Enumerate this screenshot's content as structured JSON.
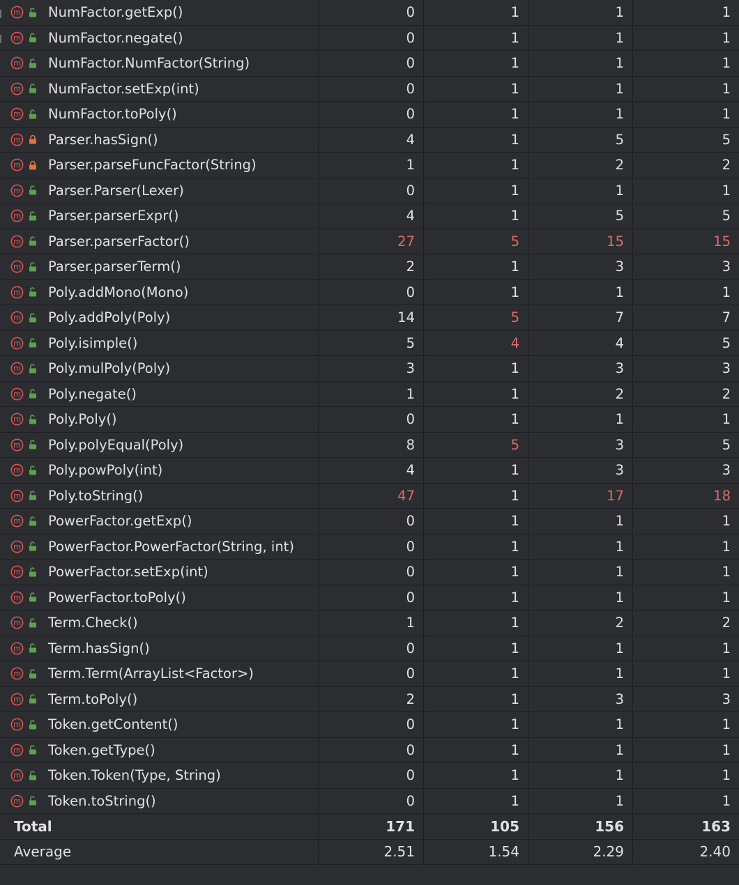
{
  "colors": {
    "background": "#2b2d30",
    "grid": "#1e1f22",
    "text": "#dfe1e5",
    "highlight": "#e06c6c",
    "method_icon": "#e05555",
    "public_lock": "#5fa04e",
    "private_lock": "#e0733d"
  },
  "rows": [
    {
      "name": "NumFactor.getExp()",
      "access": "public",
      "v": [
        "0",
        "1",
        "1",
        "1"
      ],
      "hot": [
        false,
        false,
        false,
        false
      ]
    },
    {
      "name": "NumFactor.negate()",
      "access": "public",
      "v": [
        "0",
        "1",
        "1",
        "1"
      ],
      "hot": [
        false,
        false,
        false,
        false
      ]
    },
    {
      "name": "NumFactor.NumFactor(String)",
      "access": "public",
      "v": [
        "0",
        "1",
        "1",
        "1"
      ],
      "hot": [
        false,
        false,
        false,
        false
      ]
    },
    {
      "name": "NumFactor.setExp(int)",
      "access": "public",
      "v": [
        "0",
        "1",
        "1",
        "1"
      ],
      "hot": [
        false,
        false,
        false,
        false
      ]
    },
    {
      "name": "NumFactor.toPoly()",
      "access": "public",
      "v": [
        "0",
        "1",
        "1",
        "1"
      ],
      "hot": [
        false,
        false,
        false,
        false
      ]
    },
    {
      "name": "Parser.hasSign()",
      "access": "private",
      "v": [
        "4",
        "1",
        "5",
        "5"
      ],
      "hot": [
        false,
        false,
        false,
        false
      ]
    },
    {
      "name": "Parser.parseFuncFactor(String)",
      "access": "private",
      "v": [
        "1",
        "1",
        "2",
        "2"
      ],
      "hot": [
        false,
        false,
        false,
        false
      ]
    },
    {
      "name": "Parser.Parser(Lexer)",
      "access": "public",
      "v": [
        "0",
        "1",
        "1",
        "1"
      ],
      "hot": [
        false,
        false,
        false,
        false
      ]
    },
    {
      "name": "Parser.parserExpr()",
      "access": "public",
      "v": [
        "4",
        "1",
        "5",
        "5"
      ],
      "hot": [
        false,
        false,
        false,
        false
      ]
    },
    {
      "name": "Parser.parserFactor()",
      "access": "public",
      "v": [
        "27",
        "5",
        "15",
        "15"
      ],
      "hot": [
        true,
        true,
        true,
        true
      ]
    },
    {
      "name": "Parser.parserTerm()",
      "access": "public",
      "v": [
        "2",
        "1",
        "3",
        "3"
      ],
      "hot": [
        false,
        false,
        false,
        false
      ]
    },
    {
      "name": "Poly.addMono(Mono)",
      "access": "public",
      "v": [
        "0",
        "1",
        "1",
        "1"
      ],
      "hot": [
        false,
        false,
        false,
        false
      ]
    },
    {
      "name": "Poly.addPoly(Poly)",
      "access": "public",
      "v": [
        "14",
        "5",
        "7",
        "7"
      ],
      "hot": [
        false,
        true,
        false,
        false
      ]
    },
    {
      "name": "Poly.isimple()",
      "access": "public",
      "v": [
        "5",
        "4",
        "4",
        "5"
      ],
      "hot": [
        false,
        true,
        false,
        false
      ]
    },
    {
      "name": "Poly.mulPoly(Poly)",
      "access": "public",
      "v": [
        "3",
        "1",
        "3",
        "3"
      ],
      "hot": [
        false,
        false,
        false,
        false
      ]
    },
    {
      "name": "Poly.negate()",
      "access": "public",
      "v": [
        "1",
        "1",
        "2",
        "2"
      ],
      "hot": [
        false,
        false,
        false,
        false
      ]
    },
    {
      "name": "Poly.Poly()",
      "access": "public",
      "v": [
        "0",
        "1",
        "1",
        "1"
      ],
      "hot": [
        false,
        false,
        false,
        false
      ]
    },
    {
      "name": "Poly.polyEqual(Poly)",
      "access": "public",
      "v": [
        "8",
        "5",
        "3",
        "5"
      ],
      "hot": [
        false,
        true,
        false,
        false
      ]
    },
    {
      "name": "Poly.powPoly(int)",
      "access": "public",
      "v": [
        "4",
        "1",
        "3",
        "3"
      ],
      "hot": [
        false,
        false,
        false,
        false
      ]
    },
    {
      "name": "Poly.toString()",
      "access": "public",
      "v": [
        "47",
        "1",
        "17",
        "18"
      ],
      "hot": [
        true,
        false,
        true,
        true
      ]
    },
    {
      "name": "PowerFactor.getExp()",
      "access": "public",
      "v": [
        "0",
        "1",
        "1",
        "1"
      ],
      "hot": [
        false,
        false,
        false,
        false
      ]
    },
    {
      "name": "PowerFactor.PowerFactor(String, int)",
      "access": "public",
      "v": [
        "0",
        "1",
        "1",
        "1"
      ],
      "hot": [
        false,
        false,
        false,
        false
      ]
    },
    {
      "name": "PowerFactor.setExp(int)",
      "access": "public",
      "v": [
        "0",
        "1",
        "1",
        "1"
      ],
      "hot": [
        false,
        false,
        false,
        false
      ]
    },
    {
      "name": "PowerFactor.toPoly()",
      "access": "public",
      "v": [
        "0",
        "1",
        "1",
        "1"
      ],
      "hot": [
        false,
        false,
        false,
        false
      ]
    },
    {
      "name": "Term.Check()",
      "access": "public",
      "v": [
        "1",
        "1",
        "2",
        "2"
      ],
      "hot": [
        false,
        false,
        false,
        false
      ]
    },
    {
      "name": "Term.hasSign()",
      "access": "public",
      "v": [
        "0",
        "1",
        "1",
        "1"
      ],
      "hot": [
        false,
        false,
        false,
        false
      ]
    },
    {
      "name": "Term.Term(ArrayList<Factor>)",
      "access": "public",
      "v": [
        "0",
        "1",
        "1",
        "1"
      ],
      "hot": [
        false,
        false,
        false,
        false
      ]
    },
    {
      "name": "Term.toPoly()",
      "access": "public",
      "v": [
        "2",
        "1",
        "3",
        "3"
      ],
      "hot": [
        false,
        false,
        false,
        false
      ]
    },
    {
      "name": "Token.getContent()",
      "access": "public",
      "v": [
        "0",
        "1",
        "1",
        "1"
      ],
      "hot": [
        false,
        false,
        false,
        false
      ]
    },
    {
      "name": "Token.getType()",
      "access": "public",
      "v": [
        "0",
        "1",
        "1",
        "1"
      ],
      "hot": [
        false,
        false,
        false,
        false
      ]
    },
    {
      "name": "Token.Token(Type, String)",
      "access": "public",
      "v": [
        "0",
        "1",
        "1",
        "1"
      ],
      "hot": [
        false,
        false,
        false,
        false
      ]
    },
    {
      "name": "Token.toString()",
      "access": "public",
      "v": [
        "0",
        "1",
        "1",
        "1"
      ],
      "hot": [
        false,
        false,
        false,
        false
      ]
    }
  ],
  "total": {
    "label": "Total",
    "v": [
      "171",
      "105",
      "156",
      "163"
    ]
  },
  "average": {
    "label": "Average",
    "v": [
      "2.51",
      "1.54",
      "2.29",
      "2.40"
    ]
  }
}
